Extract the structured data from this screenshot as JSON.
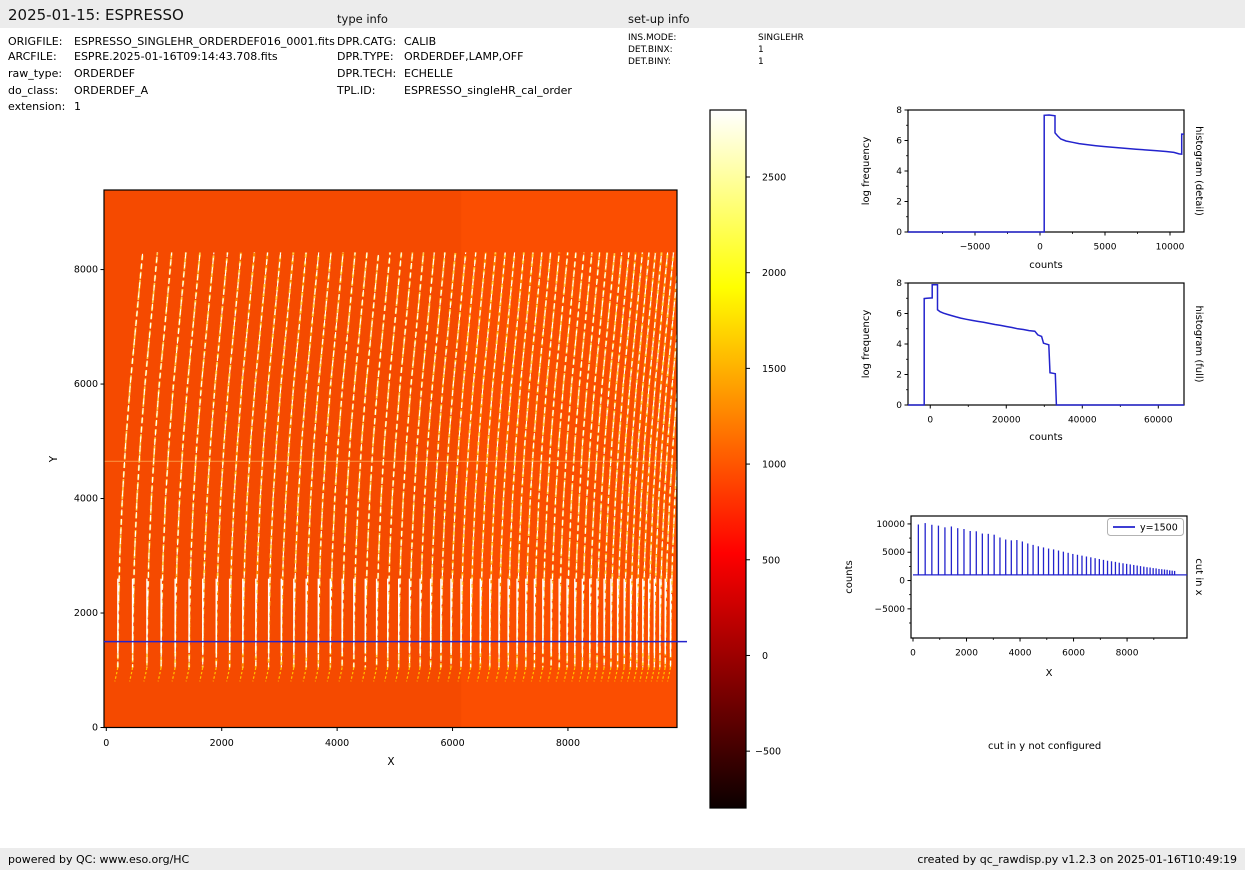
{
  "header": {
    "title": "2025-01-15: ESPRESSO",
    "type_info_title": "type info",
    "setup_info_title": "set-up info",
    "file_info": [
      {
        "label": "ORIGFILE:",
        "value": "ESPRESSO_SINGLEHR_ORDERDEF016_0001.fits"
      },
      {
        "label": "ARCFILE:",
        "value": "ESPRE.2025-01-16T09:14:43.708.fits"
      },
      {
        "label": "raw_type:",
        "value": "ORDERDEF"
      },
      {
        "label": "do_class:",
        "value": "ORDERDEF_A"
      },
      {
        "label": "extension:",
        "value": "1"
      }
    ],
    "type_info": [
      {
        "label": "DPR.CATG:",
        "value": "CALIB"
      },
      {
        "label": "DPR.TYPE:",
        "value": "ORDERDEF,LAMP,OFF"
      },
      {
        "label": "DPR.TECH:",
        "value": "ECHELLE"
      },
      {
        "label": "TPL.ID:",
        "value": "ESPRESSO_singleHR_cal_order"
      }
    ],
    "setup_info": [
      {
        "label": "INS.MODE:",
        "value": "SINGLEHR"
      },
      {
        "label": "DET.BINX:",
        "value": "1"
      },
      {
        "label": "DET.BINY:",
        "value": "1"
      }
    ]
  },
  "footer": {
    "left": "powered by QC: www.eso.org/HC",
    "right": "created by qc_rawdisp.py v1.2.3 on 2025-01-16T10:49:19"
  },
  "chart_data": [
    {
      "id": "raw_image",
      "type": "heatmap",
      "xlabel": "X",
      "ylabel": "Y",
      "xlim": [
        -40,
        9890
      ],
      "ylim": [
        0,
        9390
      ],
      "xticks": [
        0,
        2000,
        4000,
        6000,
        8000
      ],
      "yticks": [
        0,
        2000,
        4000,
        6000,
        8000
      ],
      "background_color": "#fb4e01",
      "background_value": 1050,
      "orders": {
        "count": 57,
        "y_bottom": 1050,
        "y_top": 8300,
        "x_top_offset": 430,
        "colors": {
          "core": "#ffffff",
          "glow": "#ffd24a",
          "halo": "#ff9000",
          "hook": "#ffc400"
        }
      },
      "artifact_row_y": 4650,
      "detector_half_boundary_x": 6150,
      "cut_line": {
        "y": 1500,
        "color": "#2323cd"
      }
    },
    {
      "id": "colorbar",
      "type": "colorbar",
      "cmap": "hot",
      "vmin": -797,
      "vmax": 2850,
      "ticks": [
        2500,
        2000,
        1500,
        1000,
        500,
        0,
        -500
      ],
      "gradient_stops": [
        [
          0,
          "#0b0000"
        ],
        [
          0.365,
          "#ff0000"
        ],
        [
          0.746,
          "#ffff00"
        ],
        [
          1,
          "#ffffff"
        ]
      ]
    },
    {
      "id": "histogram_detail",
      "type": "line",
      "right_label": "histogram (detail)",
      "xlabel": "counts",
      "ylabel": "log frequency",
      "xlim": [
        -10154,
        11077
      ],
      "ylim": [
        0,
        8
      ],
      "xticks": [
        -5000,
        0,
        5000,
        10000
      ],
      "yticks": [
        0,
        2,
        4,
        6,
        8
      ],
      "minor_xticks": [
        -7500,
        -2500,
        2500,
        7500
      ],
      "minor_yticks": [
        1,
        3,
        5,
        7
      ],
      "color": "#2323cd",
      "points": [
        [
          -10154,
          0
        ],
        [
          320,
          0
        ],
        [
          320,
          7.65
        ],
        [
          700,
          7.67
        ],
        [
          1150,
          7.62
        ],
        [
          1150,
          6.5
        ],
        [
          1350,
          6.3
        ],
        [
          1600,
          6.1
        ],
        [
          2000,
          5.97
        ],
        [
          2500,
          5.88
        ],
        [
          3000,
          5.8
        ],
        [
          3600,
          5.73
        ],
        [
          4300,
          5.66
        ],
        [
          5000,
          5.6
        ],
        [
          5800,
          5.54
        ],
        [
          6600,
          5.48
        ],
        [
          7400,
          5.43
        ],
        [
          8200,
          5.38
        ],
        [
          9000,
          5.33
        ],
        [
          9700,
          5.28
        ],
        [
          10300,
          5.22
        ],
        [
          10700,
          5.12
        ],
        [
          10900,
          5.1
        ],
        [
          10900,
          6.42
        ],
        [
          11077,
          6.42
        ]
      ]
    },
    {
      "id": "histogram_full",
      "type": "line",
      "right_label": "histogram (full)",
      "xlabel": "counts",
      "ylabel": "log frequency",
      "xlim": [
        -5855,
        66760
      ],
      "ylim": [
        0,
        8
      ],
      "xticks": [
        0,
        20000,
        40000,
        60000
      ],
      "yticks": [
        0,
        2,
        4,
        6,
        8
      ],
      "minor_xticks": [
        10000,
        30000,
        50000
      ],
      "minor_yticks": [
        1,
        3,
        5,
        7
      ],
      "color": "#2323cd",
      "points": [
        [
          -5855,
          0
        ],
        [
          -1600,
          0
        ],
        [
          -1600,
          6.98
        ],
        [
          -900,
          7.0
        ],
        [
          500,
          7.02
        ],
        [
          500,
          7.88
        ],
        [
          1900,
          7.88
        ],
        [
          1900,
          6.25
        ],
        [
          2600,
          6.12
        ],
        [
          3500,
          6.02
        ],
        [
          4500,
          5.94
        ],
        [
          5500,
          5.87
        ],
        [
          6800,
          5.78
        ],
        [
          8000,
          5.7
        ],
        [
          9500,
          5.62
        ],
        [
          11000,
          5.55
        ],
        [
          12500,
          5.48
        ],
        [
          14000,
          5.42
        ],
        [
          15500,
          5.35
        ],
        [
          17000,
          5.28
        ],
        [
          18500,
          5.22
        ],
        [
          20000,
          5.15
        ],
        [
          21500,
          5.08
        ],
        [
          23000,
          5.0
        ],
        [
          24500,
          4.95
        ],
        [
          26000,
          4.88
        ],
        [
          27500,
          4.84
        ],
        [
          28300,
          4.6
        ],
        [
          29300,
          4.5
        ],
        [
          29800,
          4.05
        ],
        [
          31200,
          3.95
        ],
        [
          31500,
          2.12
        ],
        [
          32900,
          2.05
        ],
        [
          33200,
          0
        ],
        [
          66760,
          0
        ]
      ]
    },
    {
      "id": "cut_in_x",
      "type": "line",
      "right_label": "cut in x",
      "xlabel": "X",
      "ylabel": "counts",
      "xlim": [
        -75,
        10240
      ],
      "ylim": [
        -10150,
        11400
      ],
      "xticks": [
        0,
        2000,
        4000,
        6000,
        8000
      ],
      "yticks": [
        -5000,
        0,
        5000,
        10000
      ],
      "minor_xticks": [
        1000,
        3000,
        5000,
        7000,
        9000
      ],
      "minor_yticks": [
        -7500,
        -2500,
        2500,
        7500
      ],
      "color": "#2323cd",
      "legend": {
        "label": "y=1500"
      },
      "baseline": 1000,
      "spike_x": [
        200,
        455,
        704,
        950,
        1193,
        1434,
        1671,
        1905,
        2137,
        2365,
        2591,
        2813,
        3033,
        3250,
        3464,
        3674,
        3882,
        4087,
        4289,
        4488,
        4684,
        4877,
        5067,
        5254,
        5438,
        5620,
        5798,
        5973,
        6146,
        6315,
        6482,
        6645,
        6806,
        6964,
        7118,
        7270,
        7419,
        7565,
        7708,
        7848,
        7985,
        8119,
        8250,
        8378,
        8503,
        8626,
        8745,
        8861,
        8975,
        9085,
        9193,
        9297,
        9399,
        9497,
        9593,
        9686,
        9777
      ],
      "spike_h": [
        9900,
        10150,
        9850,
        9700,
        9400,
        9550,
        9250,
        9100,
        8750,
        8700,
        8300,
        8250,
        8100,
        7600,
        7250,
        7100,
        7150,
        6900,
        6550,
        6300,
        6050,
        5850,
        5650,
        5500,
        5300,
        5100,
        4900,
        4700,
        4550,
        4400,
        4250,
        4100,
        3950,
        3800,
        3650,
        3500,
        3400,
        3300,
        3150,
        3050,
        2950,
        2850,
        2750,
        2650,
        2550,
        2450,
        2350,
        2300,
        2200,
        2150,
        2050,
        2000,
        1950,
        1900,
        1800,
        1750,
        1700
      ]
    },
    {
      "id": "cut_in_y_note",
      "type": "text",
      "text": "cut in y not configured"
    }
  ]
}
